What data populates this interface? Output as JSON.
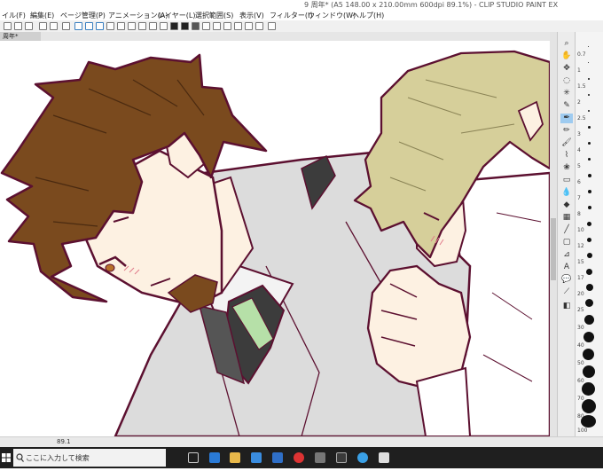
{
  "window": {
    "title": "9 周年* (A5 148.00 x 210.00mm 600dpi 89.1%) - CLIP STUDIO PAINT EX"
  },
  "menu": {
    "items": [
      "イル(F)",
      "編集(E)",
      "ページ管理(P)",
      "アニメーション(A)",
      "レイヤー(L)",
      "選択範囲(S)",
      "表示(V)",
      "フィルター(I)",
      "ウィンドウ(W)",
      "ヘルプ(H)"
    ]
  },
  "tab": {
    "label": "周年*"
  },
  "status": {
    "zoom": "89.1"
  },
  "brush_sizes": [
    "0.7",
    "1",
    "1.5",
    "2",
    "2.5",
    "3",
    "4",
    "5",
    "6",
    "7",
    "8",
    "10",
    "12",
    "15",
    "17",
    "20",
    "25",
    "30",
    "40",
    "50",
    "60",
    "70",
    "80",
    "100"
  ],
  "taskbar": {
    "search_placeholder": "ここに入力して検索"
  },
  "colors": {
    "line": "#5c1030",
    "hair_brown": "#7a4a1e",
    "hair_blond": "#d6cf9a",
    "skin": "#fdf1e2",
    "suit": "#dcdcdc",
    "tie": "#3c3c3c",
    "tie_stripe": "#b6e0a8",
    "taskbar": "#1f1f1f"
  }
}
